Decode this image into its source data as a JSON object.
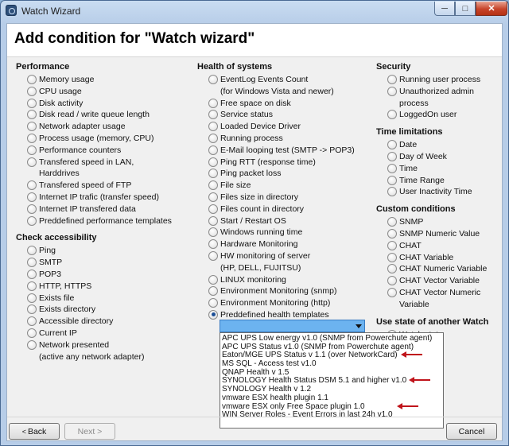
{
  "window": {
    "title": "Watch Wizard"
  },
  "page": {
    "heading": "Add condition for \"Watch wizard\""
  },
  "performance": {
    "title": "Performance",
    "items": [
      "Memory usage",
      "CPU usage",
      "Disk activity",
      "Disk read / write queue length",
      "Network adapter usage",
      "Process usage (memory, CPU)",
      "Performance counters",
      "Transfered speed in LAN,\nHarddrives",
      "Transfered speed of FTP",
      "Internet IP trafic (transfer speed)",
      "Internet IP transfered data",
      "Preddefined performance templates"
    ]
  },
  "accessibility": {
    "title": "Check accessibility",
    "items": [
      "Ping",
      "SMTP",
      "POP3",
      "HTTP, HTTPS",
      "Exists file",
      "Exists directory",
      "Accessible directory",
      "Current IP",
      "Network presented\n(active any network adapter)"
    ]
  },
  "health": {
    "title": "Health of systems",
    "items": [
      "EventLog Events Count\n(for Windows Vista and newer)",
      "Free space on disk",
      "Service status",
      "Loaded Device Driver",
      "Running process",
      "E-Mail looping test (SMTP -> POP3)",
      "Ping RTT (response time)",
      "Ping packet loss",
      "File size",
      "Files size in directory",
      "Files count in directory",
      "Start / Restart OS",
      "Windows running time",
      "Hardware Monitoring",
      "HW monitoring of server\n(HP, DELL, FUJITSU)",
      "LINUX monitoring",
      "Environment Monitoring (snmp)",
      "Environment Monitoring (http)",
      "Preddefined health templates"
    ],
    "selected_index": 18
  },
  "templates_dropdown": {
    "value": "",
    "options": [
      "APC UPS Low energy v1.0   (SNMP from Powerchute agent)",
      "APC UPS Status v1.0   (SNMP from Powerchute agent)",
      "Eaton/MGE UPS Status v 1.1 (over NetworkCard)",
      "MS SQL - Access test v1.0",
      "QNAP Health v 1.5",
      "SYNOLOGY Health Status DSM 5.1 and higher v1.0",
      "SYNOLOGY Health v 1.2",
      "vmware ESX health plugin 1.1",
      "vmware ESX only Free Space plugin 1.0",
      "WIN Server Roles - Event Errors in last 24h v1.0"
    ],
    "arrow_color": "#c0141b"
  },
  "security": {
    "title": "Security",
    "items": [
      "Running user process",
      "Unauthorized admin process",
      "LoggedOn user"
    ]
  },
  "time": {
    "title": "Time limitations",
    "items": [
      "Date",
      "Day of Week",
      "Time",
      "Time Range",
      "User Inactivity Time"
    ]
  },
  "custom": {
    "title": "Custom conditions",
    "items": [
      "SNMP",
      "SNMP Numeric Value",
      "CHAT",
      "CHAT Variable",
      "CHAT Numeric Variable",
      "CHAT Vector Variable",
      "CHAT Vector Numeric Variable"
    ]
  },
  "state": {
    "title": "Use state of another Watch",
    "items": [
      "Watch state"
    ]
  },
  "buttons": {
    "back": "Back",
    "next": "Next >",
    "cancel": "Cancel"
  },
  "icons": {
    "app": "app-icon",
    "minimize": "minimize-icon",
    "maximize": "maximize-icon",
    "close": "close-icon"
  }
}
